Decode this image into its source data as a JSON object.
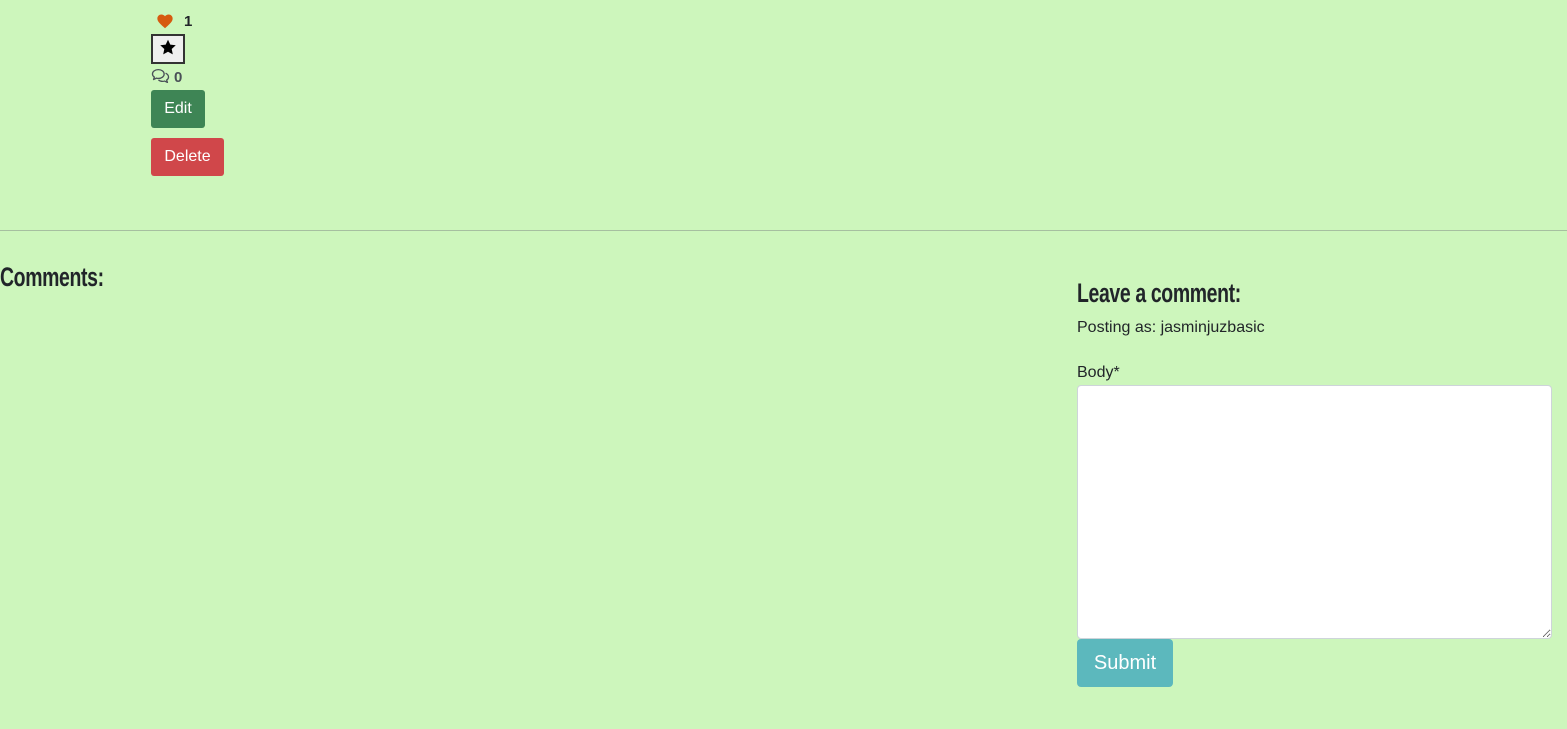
{
  "post": {
    "likes_count": "1",
    "comments_count": "0",
    "edit_label": "Edit",
    "delete_label": "Delete"
  },
  "comments": {
    "heading": "Comments:"
  },
  "comment_form": {
    "title": "Leave a comment:",
    "posting_as": "Posting as: jasminjuzbasic",
    "body_label": "Body*",
    "body_value": "",
    "submit_label": "Submit"
  },
  "colors": {
    "background": "#cdf6bc",
    "heart": "#d65a0f",
    "edit_button": "#3e8555",
    "delete_button": "#d0474a",
    "submit_button": "#5cb8bd"
  },
  "icons": {
    "like": "heart-icon",
    "favorite": "star-icon",
    "comments": "comments-icon"
  }
}
